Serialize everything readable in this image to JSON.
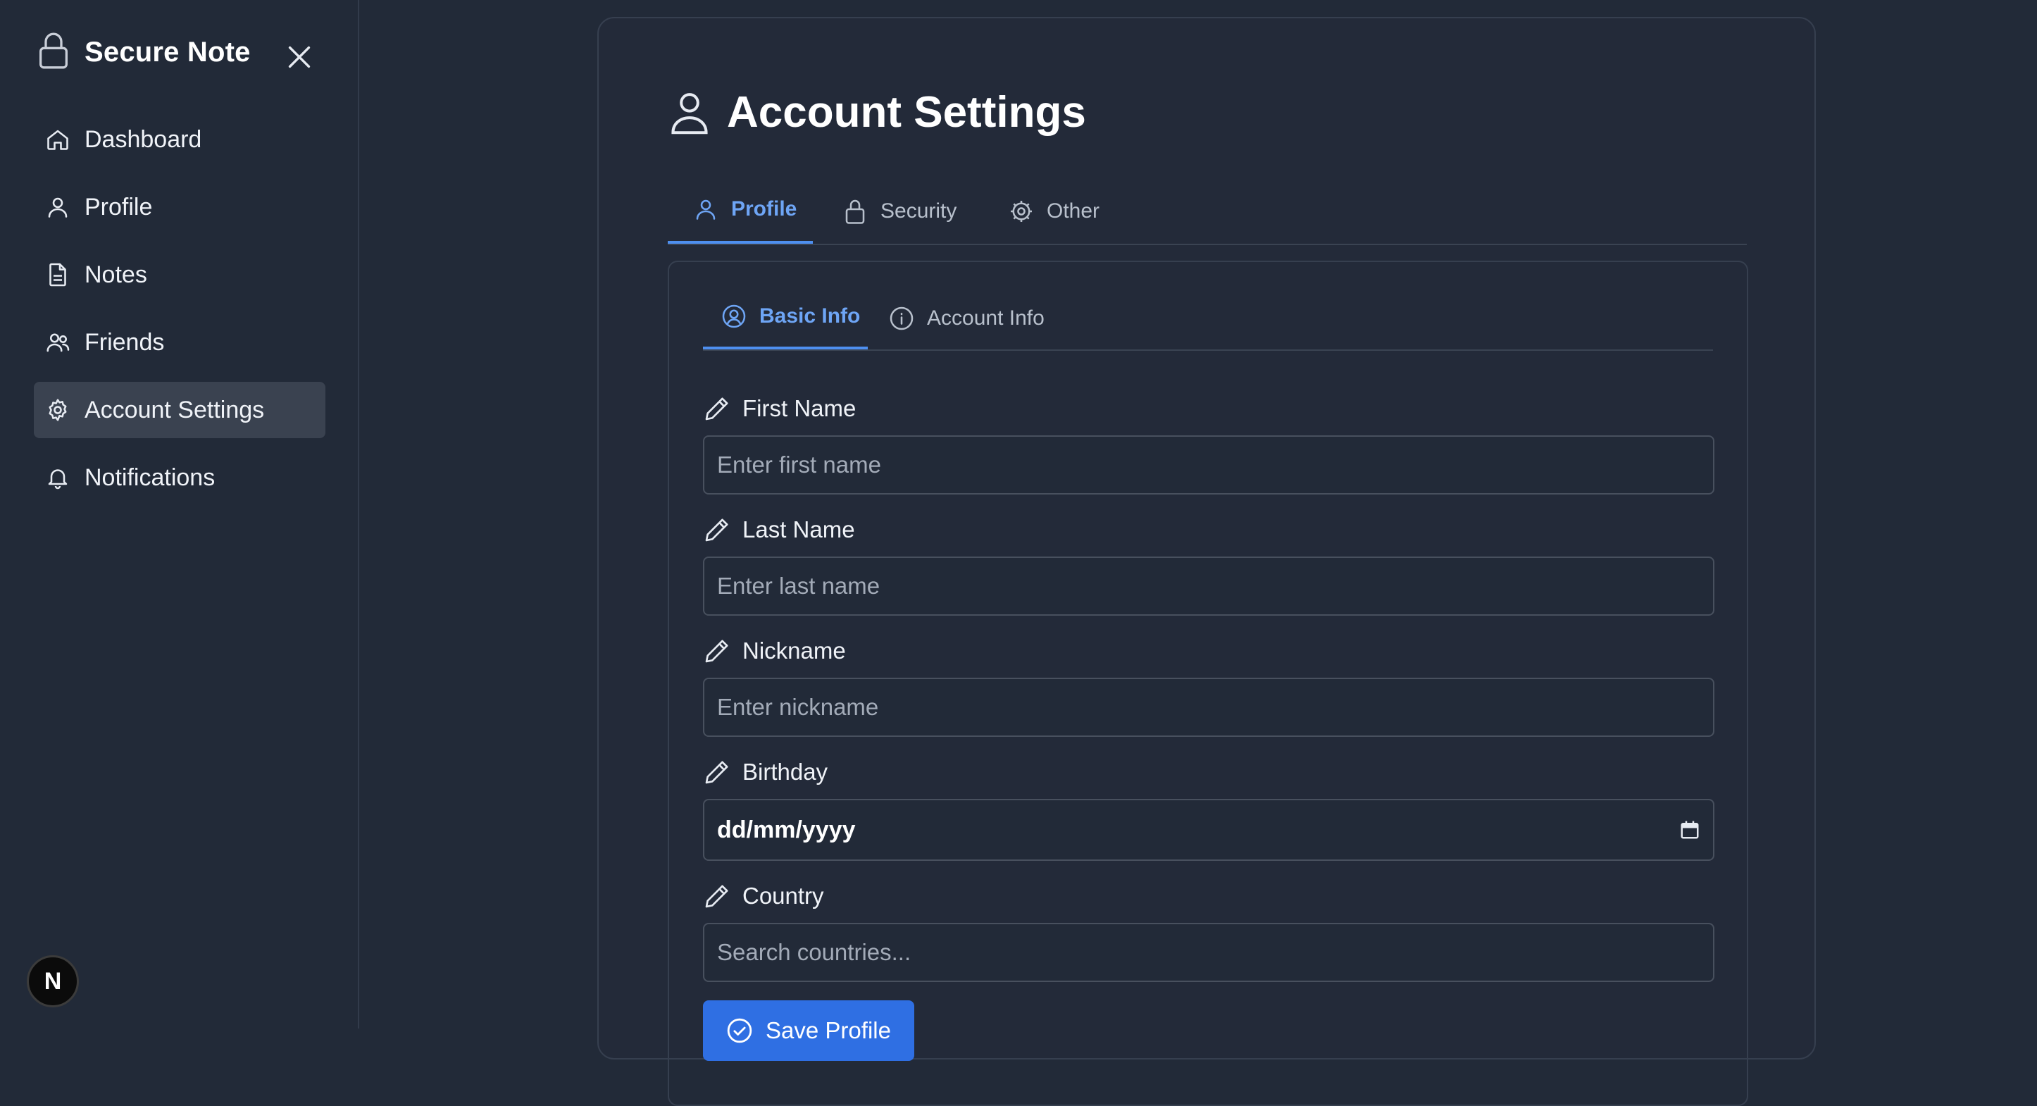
{
  "sidebar": {
    "brand_title": "Secure Note",
    "items": [
      {
        "label": "Dashboard",
        "icon": "home-icon"
      },
      {
        "label": "Profile",
        "icon": "user-icon"
      },
      {
        "label": "Notes",
        "icon": "file-text-icon"
      },
      {
        "label": "Friends",
        "icon": "users-icon"
      },
      {
        "label": "Account Settings",
        "icon": "gear-icon",
        "active": true
      },
      {
        "label": "Notifications",
        "icon": "bell-icon"
      }
    ],
    "avatar_letter": "N"
  },
  "main": {
    "title": "Account Settings",
    "tabs": [
      {
        "label": "Profile",
        "icon": "user-icon",
        "active": true
      },
      {
        "label": "Security",
        "icon": "lock-icon"
      },
      {
        "label": "Other",
        "icon": "cog-icon"
      }
    ],
    "subtabs": [
      {
        "label": "Basic Info",
        "icon": "user-circle-icon",
        "active": true
      },
      {
        "label": "Account Info",
        "icon": "info-icon"
      }
    ],
    "form": {
      "first_name": {
        "label": "First Name",
        "placeholder": "Enter first name",
        "value": ""
      },
      "last_name": {
        "label": "Last Name",
        "placeholder": "Enter last name",
        "value": ""
      },
      "nickname": {
        "label": "Nickname",
        "placeholder": "Enter nickname",
        "value": ""
      },
      "birthday": {
        "label": "Birthday",
        "value": "dd/mm/yyyy"
      },
      "country": {
        "label": "Country",
        "placeholder": "Search countries...",
        "value": ""
      }
    },
    "save_label": "Save Profile"
  },
  "colors": {
    "background": "#222a38",
    "accent": "#4e8fef",
    "active_tab_text": "#6ea5f5",
    "button": "#2f6fe3"
  }
}
